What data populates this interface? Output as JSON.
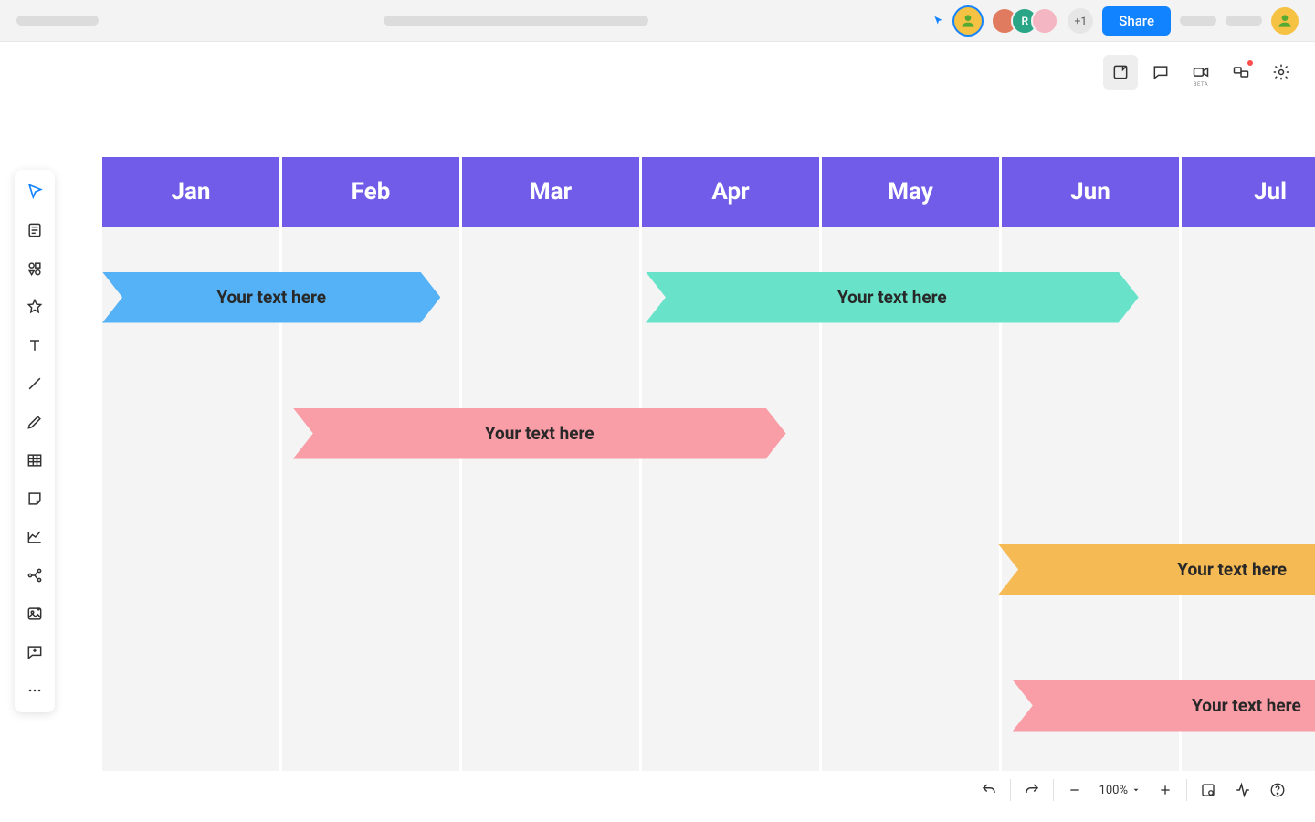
{
  "header": {
    "share_label": "Share",
    "overflow_count": "+1"
  },
  "timeline": {
    "months": [
      "Jan",
      "Feb",
      "Mar",
      "Apr",
      "May",
      "Jun",
      "Jul"
    ],
    "rows": 4,
    "tasks": [
      {
        "row": 0,
        "start": 0,
        "span": 1.88,
        "color": "blue",
        "text": "Your text here"
      },
      {
        "row": 0,
        "start": 3.02,
        "span": 2.74,
        "color": "teal",
        "text": "Your text here"
      },
      {
        "row": 1,
        "start": 1.06,
        "span": 2.74,
        "color": "pink",
        "text": "Your text here"
      },
      {
        "row": 2,
        "start": 4.98,
        "span": 2.6,
        "color": "orange",
        "text": "Your text here"
      },
      {
        "row": 3,
        "start": 5.06,
        "span": 2.6,
        "color": "pink",
        "text": "Your text here"
      }
    ]
  },
  "zoom": {
    "label": "100%"
  },
  "avatars": [
    {
      "bg": "#F6C244"
    },
    {
      "bg": "#E07B5F"
    },
    {
      "bg": "#2AA586",
      "letter": "R"
    },
    {
      "bg": "#F4B6C2"
    }
  ],
  "action_icons": [
    "notes",
    "comments",
    "video",
    "huddle",
    "settings"
  ],
  "tools": [
    "select",
    "frame",
    "shapes",
    "star",
    "text",
    "line",
    "pen",
    "table",
    "sticky",
    "chart",
    "mindmap",
    "image",
    "comment",
    "more"
  ]
}
